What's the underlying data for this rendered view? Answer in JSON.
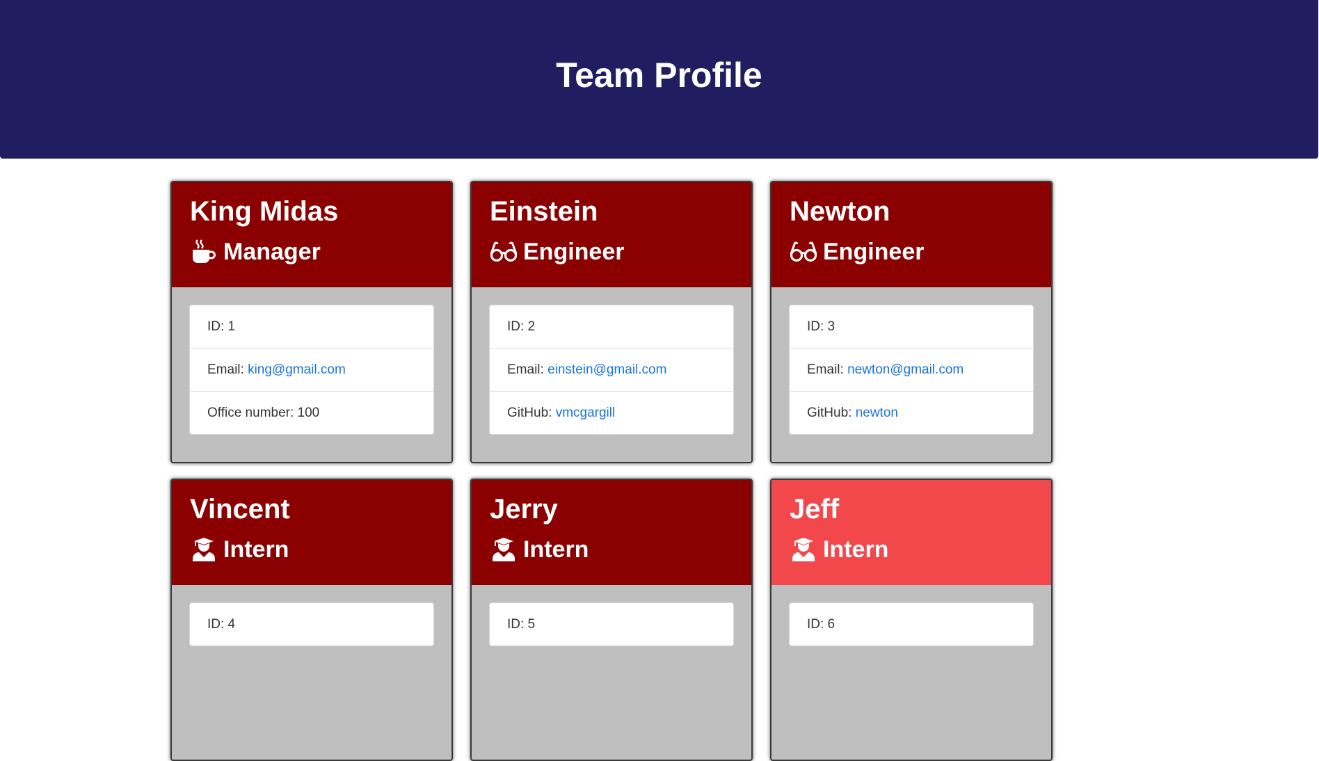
{
  "header": {
    "title": "Team Profile",
    "background_color": "#201e60"
  },
  "colors": {
    "card_header": "#8b0000",
    "card_header_highlight": "#f3484b",
    "card_body": "#bfbfbf",
    "link": "#1a73d9"
  },
  "team": [
    {
      "name": "King Midas",
      "role": "Manager",
      "icon": "coffee-icon",
      "id_label": "ID: 1",
      "email_label": "Email: ",
      "email": "king@gmail.com",
      "extra_label": "Office number: 100",
      "extra_link": ""
    },
    {
      "name": "Einstein",
      "role": "Engineer",
      "icon": "glasses-icon",
      "id_label": "ID: 2",
      "email_label": "Email: ",
      "email": "einstein@gmail.com",
      "extra_label": "GitHub: ",
      "extra_link": "vmcgargill"
    },
    {
      "name": "Newton",
      "role": "Engineer",
      "icon": "glasses-icon",
      "id_label": "ID: 3",
      "email_label": "Email: ",
      "email": "newton@gmail.com",
      "extra_label": "GitHub: ",
      "extra_link": "newton"
    },
    {
      "name": "Vincent",
      "role": "Intern",
      "icon": "graduate-icon",
      "id_label": "ID: 4"
    },
    {
      "name": "Jerry",
      "role": "Intern",
      "icon": "graduate-icon",
      "id_label": "ID: 5"
    },
    {
      "name": "Jeff",
      "role": "Intern",
      "icon": "graduate-icon",
      "id_label": "ID: 6",
      "highlighted": true
    }
  ]
}
